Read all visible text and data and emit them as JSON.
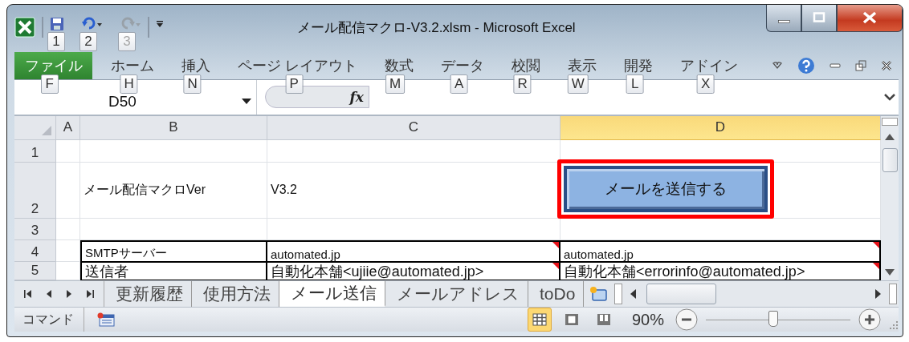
{
  "window": {
    "title": "メール配信マクロ-V3.2.xlsm - Microsoft Excel"
  },
  "quick_access": [
    {
      "kind": "save",
      "key_tip": "1",
      "disabled": false
    },
    {
      "kind": "undo",
      "key_tip": "2",
      "disabled": false
    },
    {
      "kind": "redo",
      "key_tip": "3",
      "disabled": true
    }
  ],
  "ribbon_tabs": [
    {
      "label": "ファイル",
      "kind": "file",
      "key_tip": "F"
    },
    {
      "label": "ホーム",
      "kind": "tab",
      "key_tip": "H"
    },
    {
      "label": "挿入",
      "kind": "tab",
      "key_tip": "N"
    },
    {
      "label": "ページ レイアウト",
      "kind": "tab",
      "key_tip": "P"
    },
    {
      "label": "数式",
      "kind": "tab",
      "key_tip": "M"
    },
    {
      "label": "データ",
      "kind": "tab",
      "key_tip": "A"
    },
    {
      "label": "校閲",
      "kind": "tab",
      "key_tip": "R"
    },
    {
      "label": "表示",
      "kind": "tab",
      "key_tip": "W"
    },
    {
      "label": "開発",
      "kind": "tab",
      "key_tip": "L"
    },
    {
      "label": "アドイン",
      "kind": "tab",
      "key_tip": "X"
    }
  ],
  "formula_bar": {
    "name_box": "D50",
    "function_label": "fx"
  },
  "columns": [
    {
      "label": "A",
      "selected": false
    },
    {
      "label": "B",
      "selected": false
    },
    {
      "label": "C",
      "selected": false
    },
    {
      "label": "D",
      "selected": true
    }
  ],
  "rows": [
    {
      "header": "1",
      "cells": [
        null,
        null,
        null,
        null
      ]
    },
    {
      "header": "2",
      "cells": [
        null,
        {
          "text": "メール配信マクロVer",
          "comment": false
        },
        {
          "text": "V3.2",
          "comment": false
        },
        null
      ],
      "button": {
        "label": "メールを送信する",
        "highlighted": true
      }
    },
    {
      "header": "3",
      "cells": [
        null,
        null,
        null,
        null
      ]
    }
  ],
  "settings_table": {
    "rows": [
      {
        "header": "4",
        "cells": [
          null,
          {
            "text": "SMTPサーバー",
            "comment": false
          },
          {
            "text": "automated.jp",
            "comment": true
          },
          {
            "text": "automated.jp",
            "comment": true
          }
        ]
      },
      {
        "header": "5",
        "cells": [
          null,
          {
            "text": "送信者",
            "comment": false
          },
          {
            "text": "自動化本舗<ujiie@automated.jp>",
            "comment": true
          },
          {
            "text": "自動化本舗<errorinfo@automated.jp>",
            "comment": true
          }
        ]
      }
    ]
  },
  "sheet_tabs": [
    {
      "label": "更新履歴",
      "selected": false
    },
    {
      "label": "使用方法",
      "selected": false
    },
    {
      "label": "メール送信",
      "selected": true
    },
    {
      "label": "メールアドレス",
      "selected": false
    },
    {
      "label": "toDo",
      "selected": false
    }
  ],
  "status_bar": {
    "mode": "コマンド",
    "views": [
      {
        "kind": "normal",
        "selected": true
      },
      {
        "kind": "page_layout",
        "selected": false
      },
      {
        "kind": "page_break",
        "selected": false
      }
    ],
    "zoom": "90%",
    "zoom_slider": {
      "level": 0.46
    }
  }
}
